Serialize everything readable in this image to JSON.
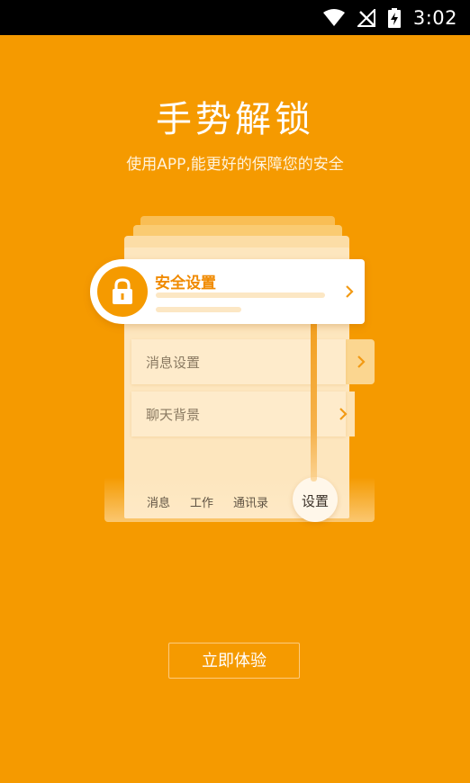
{
  "status_bar": {
    "time": "3:02",
    "icons": [
      "wifi-icon",
      "no-signal-icon",
      "battery-charging-icon"
    ]
  },
  "header": {
    "title": "手势解锁",
    "subtitle": "使用APP,能更好的保障您的安全"
  },
  "illustration": {
    "highlight_row": {
      "label": "安全设置",
      "icon": "lock-icon"
    },
    "rows": [
      {
        "label": "消息设置"
      },
      {
        "label": "聊天背景"
      }
    ],
    "tabs": [
      {
        "label": "消息"
      },
      {
        "label": "工作"
      },
      {
        "label": "通讯录"
      },
      {
        "label": "设置"
      }
    ],
    "accent_color": "#F59A00"
  },
  "cta": {
    "label": "立即体验"
  }
}
